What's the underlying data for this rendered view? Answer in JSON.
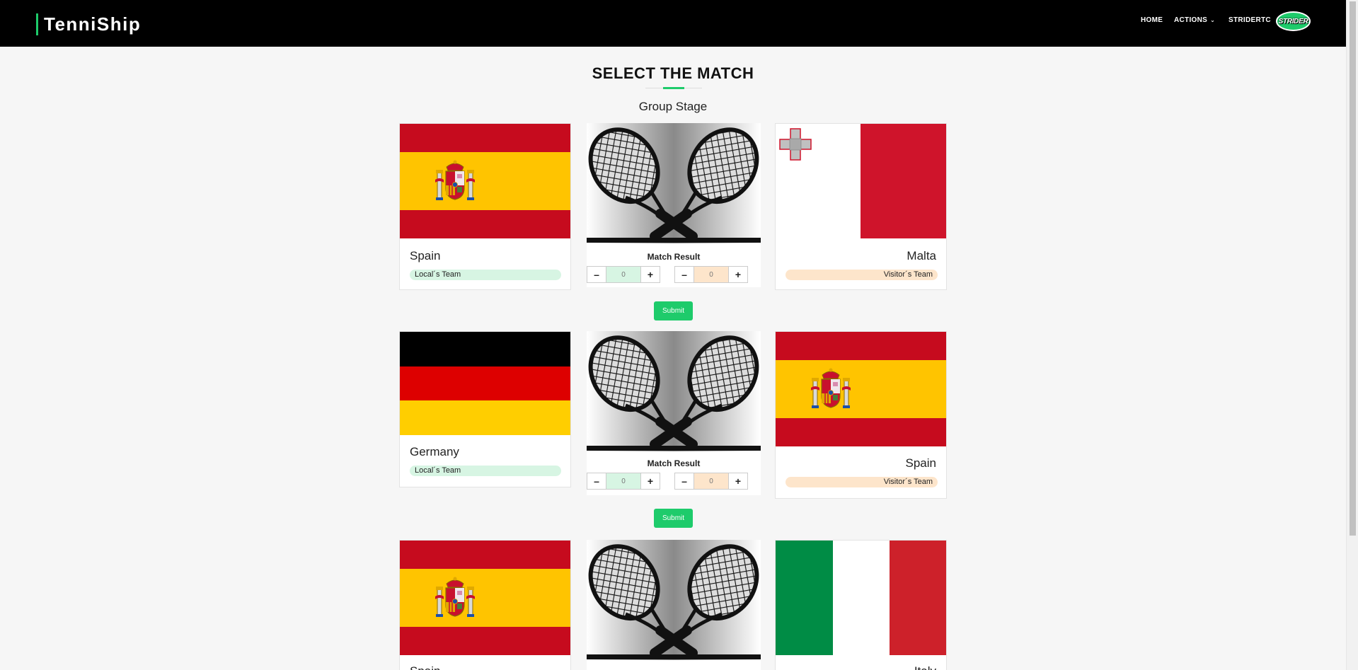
{
  "navbar": {
    "brand": "TenniShip",
    "links": {
      "home": "HOME",
      "actions": "ACTIONS",
      "user": "STRIDERTC"
    },
    "actions_caret": "⌄",
    "logo_text": "STRIDER"
  },
  "page": {
    "title": "SELECT THE MATCH",
    "stage": "Group Stage"
  },
  "matches": [
    {
      "local": {
        "name": "Spain",
        "badge": "Local´s Team",
        "flag": "spain"
      },
      "visitor": {
        "name": "Malta",
        "badge": "Visitor´s Team",
        "flag": "malta"
      },
      "result_label": "Match Result",
      "local_score": "0",
      "visitor_score": "0",
      "submit_label": "Submit"
    },
    {
      "local": {
        "name": "Germany",
        "badge": "Local´s Team",
        "flag": "germany"
      },
      "visitor": {
        "name": "Spain",
        "badge": "Visitor´s Team",
        "flag": "spain"
      },
      "result_label": "Match Result",
      "local_score": "0",
      "visitor_score": "0",
      "submit_label": "Submit"
    },
    {
      "local": {
        "name": "Spain",
        "flag": "spain"
      },
      "visitor": {
        "name": "Italy",
        "flag": "italy"
      }
    }
  ],
  "stepper": {
    "minus": "–",
    "plus": "+"
  },
  "colors": {
    "accent": "#1ecb6b",
    "navbar": "#000000",
    "local_badge": "#d7f5e3",
    "visitor_badge": "#fde5cb"
  }
}
